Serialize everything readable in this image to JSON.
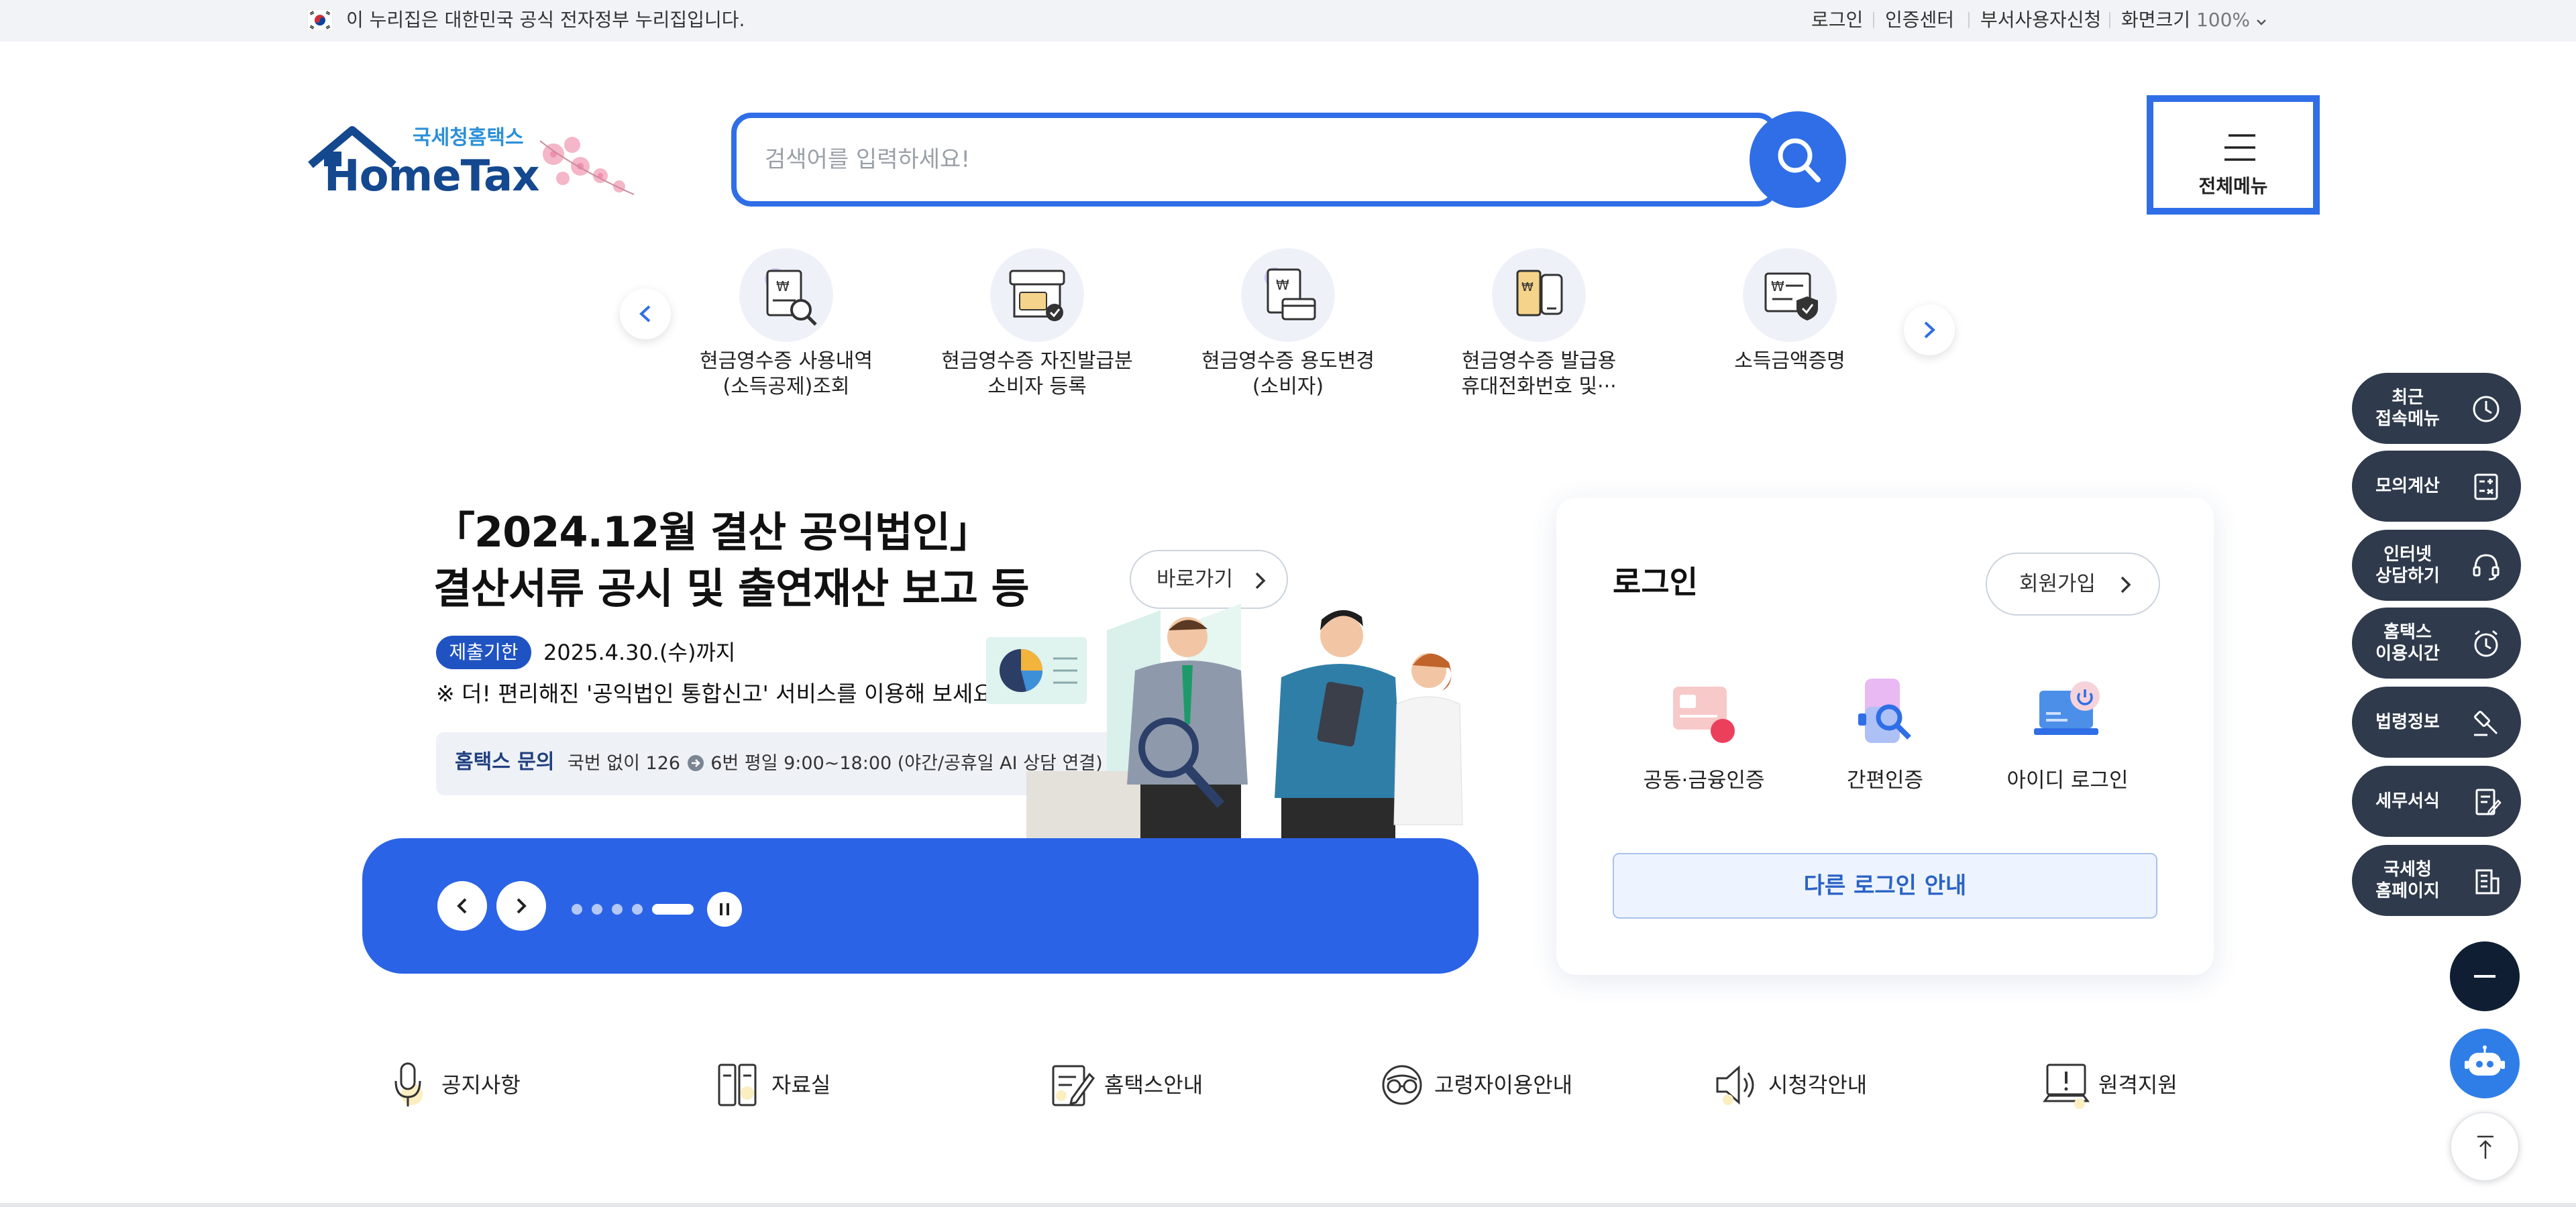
{
  "govbar": {
    "notice": "이 누리집은 대한민국 공식 전자정부 누리집입니다.",
    "links": [
      "로그인",
      "인증센터",
      "부서사용자신청"
    ],
    "zoom_label": "화면크기",
    "zoom_value": "100%"
  },
  "logo": {
    "sub": "국세청홈택스",
    "main": "HomeTax"
  },
  "search": {
    "placeholder": "검색어를 입력하세요!"
  },
  "allmenu": {
    "label": "전체메뉴"
  },
  "services": [
    {
      "line1": "현금영수증 사용내역",
      "line2": "(소득공제)조회"
    },
    {
      "line1": "현금영수증 자진발급분",
      "line2": "소비자 등록"
    },
    {
      "line1": "현금영수증 용도변경",
      "line2": "(소비자)"
    },
    {
      "line1": "현금영수증 발급용",
      "line2": "휴대전화번호 및···"
    },
    {
      "line1": "소득금액증명",
      "line2": ""
    }
  ],
  "banner": {
    "title1": "「2024.12월 결산 공익법인」",
    "title2": "결산서류 공시 및 출연재산 보고 등",
    "go": "바로가기",
    "badge": "제출기한",
    "due": "2025.4.30.(수)까지",
    "note": "※ 더! 편리해진 '공익법인 통합신고' 서비스를 이용해 보세요!",
    "inquiry_label": "홈택스 문의",
    "inquiry_a": "국번 없이 126",
    "inquiry_b": "6번 평일 9:00~18:00 (야간/공휴일 AI 상담 연결)",
    "slide_count": 5,
    "active_slide": 5
  },
  "login": {
    "title": "로그인",
    "join": "회원가입",
    "methods": [
      "공동·금융인증",
      "간편인증",
      "아이디 로그인"
    ],
    "other": "다른 로그인 안내"
  },
  "bottom_nav": [
    "공지사항",
    "자료실",
    "홈택스안내",
    "고령자이용안내",
    "시청각안내",
    "원격지원"
  ],
  "quick_menu": [
    {
      "l1": "최근",
      "l2": "접속메뉴"
    },
    {
      "l1": "모의계산",
      "l2": ""
    },
    {
      "l1": "인터넷",
      "l2": "상담하기"
    },
    {
      "l1": "홈택스",
      "l2": "이용시간"
    },
    {
      "l1": "법령정보",
      "l2": ""
    },
    {
      "l1": "세무서식",
      "l2": ""
    },
    {
      "l1": "국세청",
      "l2": "홈페이지"
    }
  ],
  "colors": {
    "primary": "#2f6ee6",
    "navy": "#14488f",
    "quick": "#2f3a4c"
  }
}
